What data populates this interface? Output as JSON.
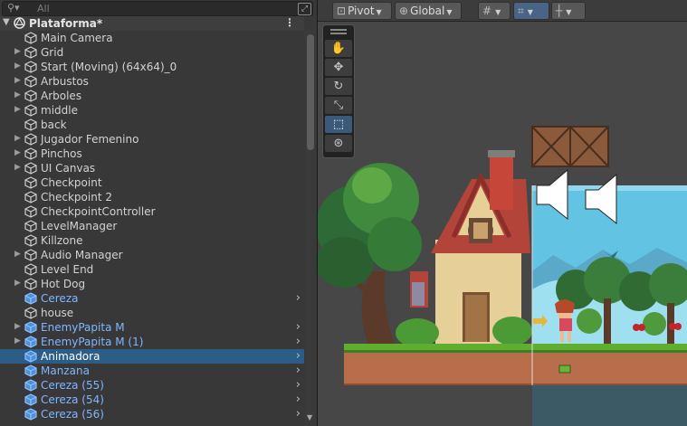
{
  "hierarchy": {
    "search_placeholder": "All",
    "scene_name": "Plataforma*",
    "items": [
      {
        "label": "Main Camera",
        "expandable": false,
        "prefab": false,
        "selected": false,
        "chevron": false
      },
      {
        "label": "Grid",
        "expandable": true,
        "prefab": false,
        "selected": false,
        "chevron": false
      },
      {
        "label": "Start (Moving) (64x64)_0",
        "expandable": true,
        "prefab": false,
        "selected": false,
        "chevron": false
      },
      {
        "label": "Arbustos",
        "expandable": true,
        "prefab": false,
        "selected": false,
        "chevron": false
      },
      {
        "label": "Arboles",
        "expandable": true,
        "prefab": false,
        "selected": false,
        "chevron": false
      },
      {
        "label": "middle",
        "expandable": true,
        "prefab": false,
        "selected": false,
        "chevron": false
      },
      {
        "label": "back",
        "expandable": false,
        "prefab": false,
        "selected": false,
        "chevron": false
      },
      {
        "label": "Jugador Femenino",
        "expandable": true,
        "prefab": false,
        "selected": false,
        "chevron": false
      },
      {
        "label": "Pinchos",
        "expandable": true,
        "prefab": false,
        "selected": false,
        "chevron": false
      },
      {
        "label": "UI Canvas",
        "expandable": true,
        "prefab": false,
        "selected": false,
        "chevron": false
      },
      {
        "label": "Checkpoint",
        "expandable": false,
        "prefab": false,
        "selected": false,
        "chevron": false
      },
      {
        "label": "Checkpoint 2",
        "expandable": false,
        "prefab": false,
        "selected": false,
        "chevron": false
      },
      {
        "label": "CheckpointController",
        "expandable": false,
        "prefab": false,
        "selected": false,
        "chevron": false
      },
      {
        "label": "LevelManager",
        "expandable": false,
        "prefab": false,
        "selected": false,
        "chevron": false
      },
      {
        "label": "Killzone",
        "expandable": false,
        "prefab": false,
        "selected": false,
        "chevron": false
      },
      {
        "label": "Audio Manager",
        "expandable": true,
        "prefab": false,
        "selected": false,
        "chevron": false
      },
      {
        "label": "Level End",
        "expandable": false,
        "prefab": false,
        "selected": false,
        "chevron": false
      },
      {
        "label": "Hot Dog",
        "expandable": true,
        "prefab": false,
        "selected": false,
        "chevron": false
      },
      {
        "label": "Cereza",
        "expandable": false,
        "prefab": true,
        "selected": false,
        "chevron": true
      },
      {
        "label": "house",
        "expandable": false,
        "prefab": false,
        "selected": false,
        "chevron": false
      },
      {
        "label": "EnemyPapita M",
        "expandable": true,
        "prefab": true,
        "selected": false,
        "chevron": true
      },
      {
        "label": "EnemyPapita M (1)",
        "expandable": true,
        "prefab": true,
        "selected": false,
        "chevron": true
      },
      {
        "label": "Animadora",
        "expandable": false,
        "prefab": true,
        "selected": true,
        "chevron": true
      },
      {
        "label": "Manzana",
        "expandable": false,
        "prefab": true,
        "selected": false,
        "chevron": true
      },
      {
        "label": "Cereza (55)",
        "expandable": false,
        "prefab": true,
        "selected": false,
        "chevron": true
      },
      {
        "label": "Cereza (54)",
        "expandable": false,
        "prefab": true,
        "selected": false,
        "chevron": true
      },
      {
        "label": "Cereza (56)",
        "expandable": false,
        "prefab": true,
        "selected": false,
        "chevron": true
      }
    ]
  },
  "toolbar": {
    "pivot_label": "Pivot",
    "global_label": "Global"
  },
  "colors": {
    "prefab_text": "#7fb7ff",
    "selection": "#2c5d87",
    "sky": "#6ec9e6",
    "grass": "#5fae2f",
    "dirt": "#b96e4b"
  }
}
